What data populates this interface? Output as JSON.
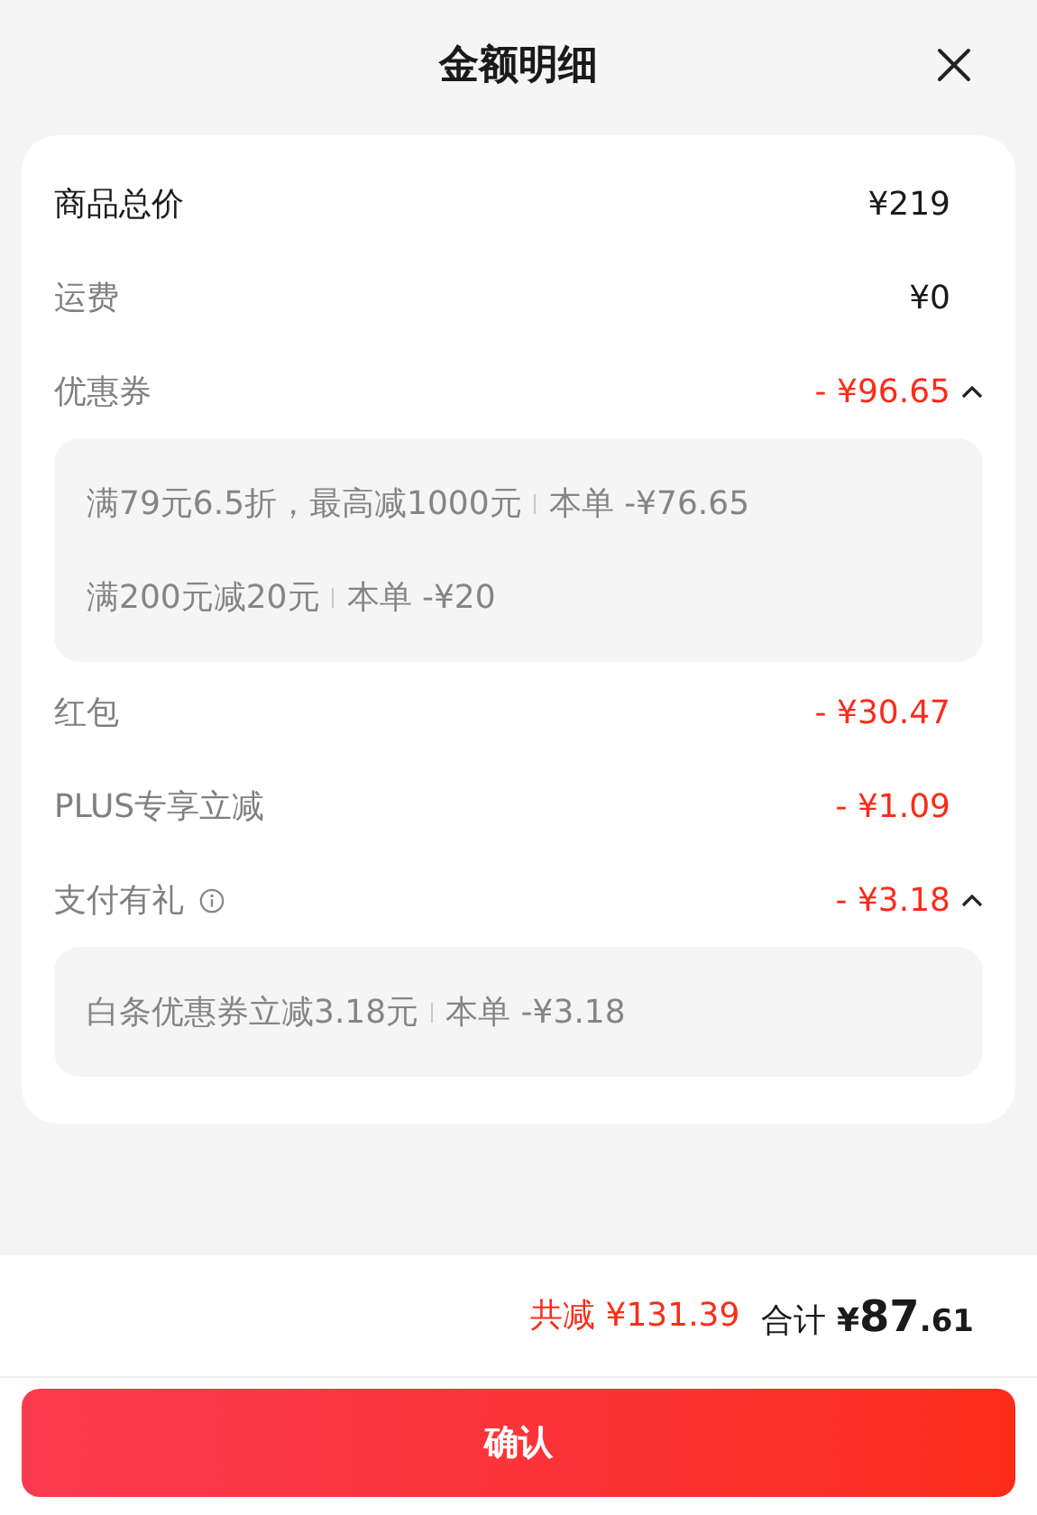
{
  "title": "金额明细",
  "rows": [
    {
      "label": "商品总价",
      "amount": "¥219",
      "discount": false,
      "primary": true
    },
    {
      "label": "运费",
      "amount": "¥0",
      "discount": false,
      "primary": false
    },
    {
      "label": "优惠券",
      "amount": "- ¥96.65",
      "discount": true,
      "primary": false,
      "expanded": true,
      "details": [
        {
          "condition": "满79元6.5折，最高减1000元",
          "value": "本单 -¥76.65"
        },
        {
          "condition": "满200元减20元",
          "value": "本单 -¥20"
        }
      ]
    },
    {
      "label": "红包",
      "amount": "- ¥30.47",
      "discount": true,
      "primary": false
    },
    {
      "label": "PLUS专享立减",
      "amount": "- ¥1.09",
      "discount": true,
      "primary": false
    },
    {
      "label": "支付有礼",
      "amount": "- ¥3.18",
      "discount": true,
      "primary": false,
      "info": true,
      "expanded": true,
      "details": [
        {
          "condition": "白条优惠券立减3.18元",
          "value": "本单 -¥3.18"
        }
      ]
    }
  ],
  "summary": {
    "saved": "共减 ¥131.39",
    "total_label": "合计",
    "currency": "¥",
    "integer": "87",
    "decimal": ".61"
  },
  "confirm_button": "确认"
}
